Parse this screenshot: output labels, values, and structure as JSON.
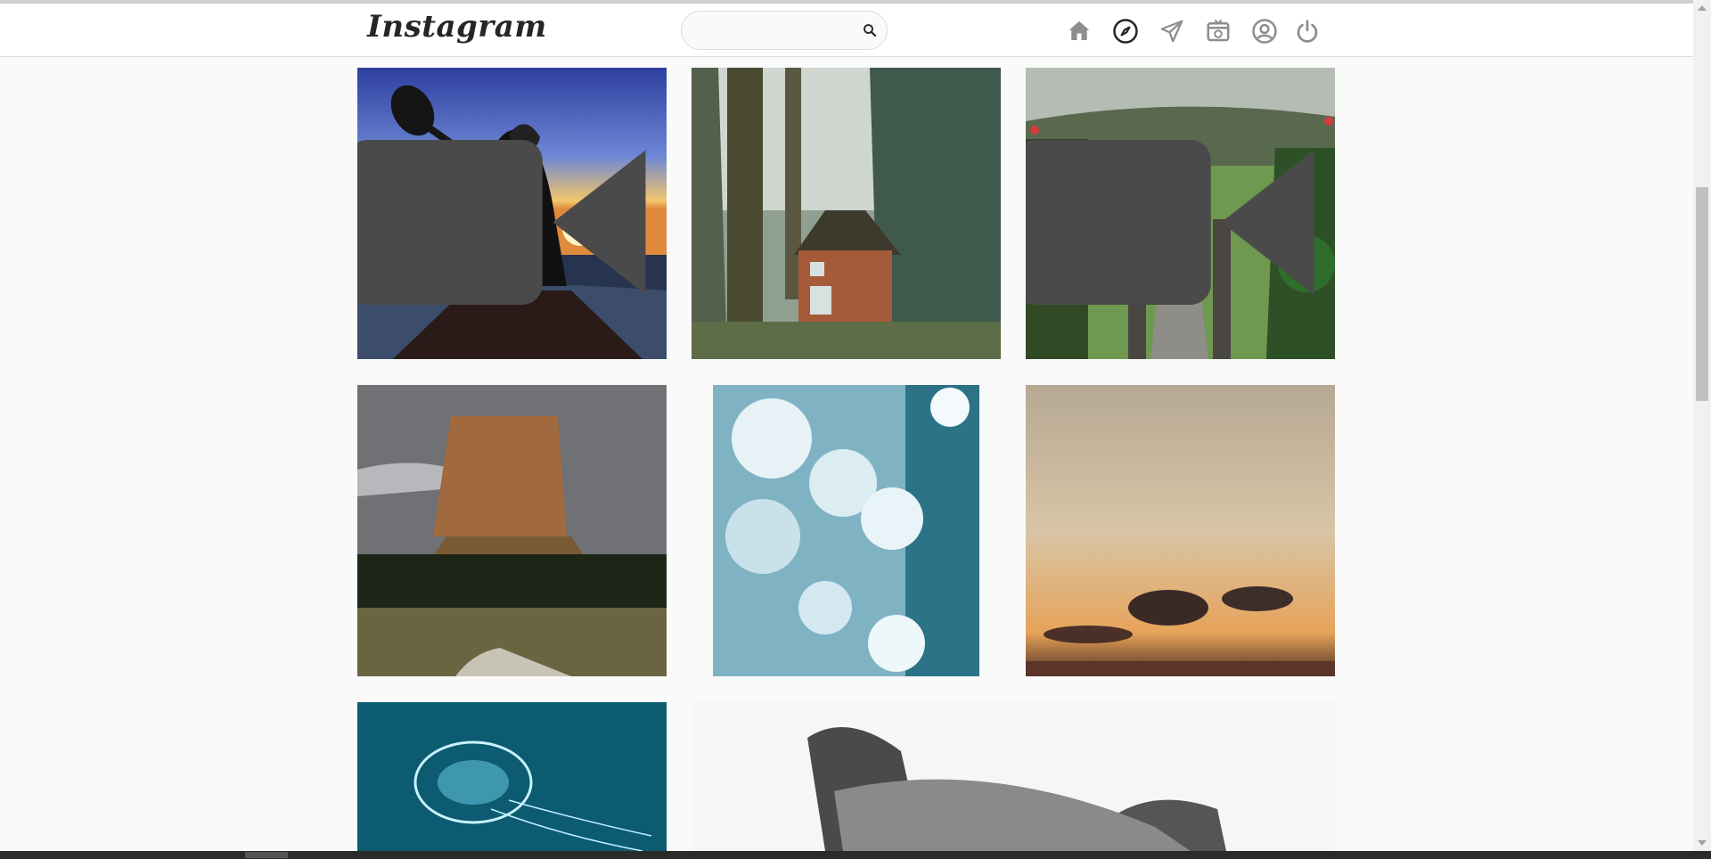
{
  "header": {
    "logo_text": "Instagram",
    "search": {
      "value": "",
      "placeholder": ""
    }
  },
  "nav_icons": [
    "home-icon",
    "explore-icon",
    "direct-icon",
    "igtv-icon",
    "profile-icon",
    "logout-icon"
  ],
  "posts": [
    {
      "subject": "kayaker-sunset",
      "has_video": true
    },
    {
      "subject": "forest-cabin",
      "has_video": false
    },
    {
      "subject": "temple-garden-path",
      "has_video": true
    },
    {
      "subject": "devils-tower",
      "has_video": false
    },
    {
      "subject": "blue-flowers",
      "has_video": false
    },
    {
      "subject": "sunset-clouds",
      "has_video": false
    },
    {
      "subject": "jellyfish",
      "has_video": false
    },
    {
      "subject": "dog-bw",
      "has_video": false
    }
  ],
  "colors": {
    "icon": "#8e8e8e",
    "text": "#262626",
    "border": "#dbdbdb",
    "bg": "#fafafa"
  }
}
